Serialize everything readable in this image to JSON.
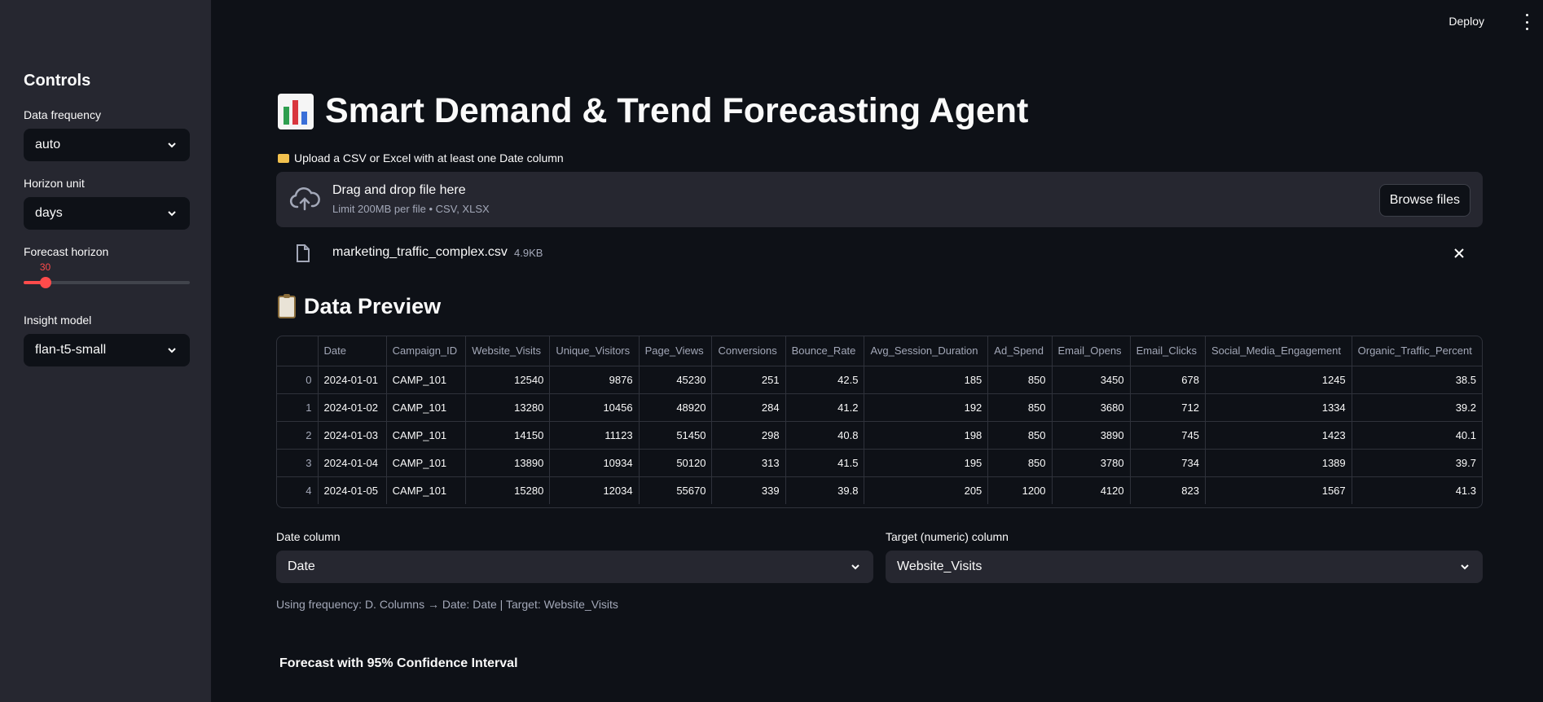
{
  "topbar": {
    "deploy_label": "Deploy"
  },
  "sidebar": {
    "title": "Controls",
    "frequency": {
      "label": "Data frequency",
      "value": "auto"
    },
    "horizon_unit": {
      "label": "Horizon unit",
      "value": "days"
    },
    "forecast_horizon": {
      "label": "Forecast horizon",
      "value": "30",
      "fraction": 0.13
    },
    "insight_model": {
      "label": "Insight model",
      "value": "flan-t5-small"
    }
  },
  "main": {
    "title": "Smart Demand & Trend Forecasting Agent",
    "upload_label": "Upload a CSV or Excel with at least one Date column",
    "dropzone": {
      "title": "Drag and drop file here",
      "subtitle": "Limit 200MB per file • CSV, XLSX",
      "browse_label": "Browse files"
    },
    "file": {
      "name": "marketing_traffic_complex.csv",
      "size": "4.9KB"
    },
    "preview_title": "Data Preview",
    "table": {
      "columns": [
        "",
        "Date",
        "Campaign_ID",
        "Website_Visits",
        "Unique_Visitors",
        "Page_Views",
        "Conversions",
        "Bounce_Rate",
        "Avg_Session_Duration",
        "Ad_Spend",
        "Email_Opens",
        "Email_Clicks",
        "Social_Media_Engagement",
        "Organic_Traffic_Percent"
      ],
      "rows": [
        [
          "0",
          "2024-01-01",
          "CAMP_101",
          "12540",
          "9876",
          "45230",
          "251",
          "42.5",
          "185",
          "850",
          "3450",
          "678",
          "1245",
          "38.5"
        ],
        [
          "1",
          "2024-01-02",
          "CAMP_101",
          "13280",
          "10456",
          "48920",
          "284",
          "41.2",
          "192",
          "850",
          "3680",
          "712",
          "1334",
          "39.2"
        ],
        [
          "2",
          "2024-01-03",
          "CAMP_101",
          "14150",
          "11123",
          "51450",
          "298",
          "40.8",
          "198",
          "850",
          "3890",
          "745",
          "1423",
          "40.1"
        ],
        [
          "3",
          "2024-01-04",
          "CAMP_101",
          "13890",
          "10934",
          "50120",
          "313",
          "41.5",
          "195",
          "850",
          "3780",
          "734",
          "1389",
          "39.7"
        ],
        [
          "4",
          "2024-01-05",
          "CAMP_101",
          "15280",
          "12034",
          "55670",
          "339",
          "39.8",
          "205",
          "1200",
          "4120",
          "823",
          "1567",
          "41.3"
        ]
      ]
    },
    "date_column": {
      "label": "Date column",
      "value": "Date"
    },
    "target_column": {
      "label": "Target (numeric) column",
      "value": "Website_Visits"
    },
    "caption": "Using frequency: D. Columns → Date: Date | Target: Website_Visits",
    "forecast_title": "Forecast with 95% Confidence Interval"
  },
  "colors": {
    "accent": "#ff4b4b",
    "background": "#0e1117",
    "sidebar": "#262730"
  }
}
